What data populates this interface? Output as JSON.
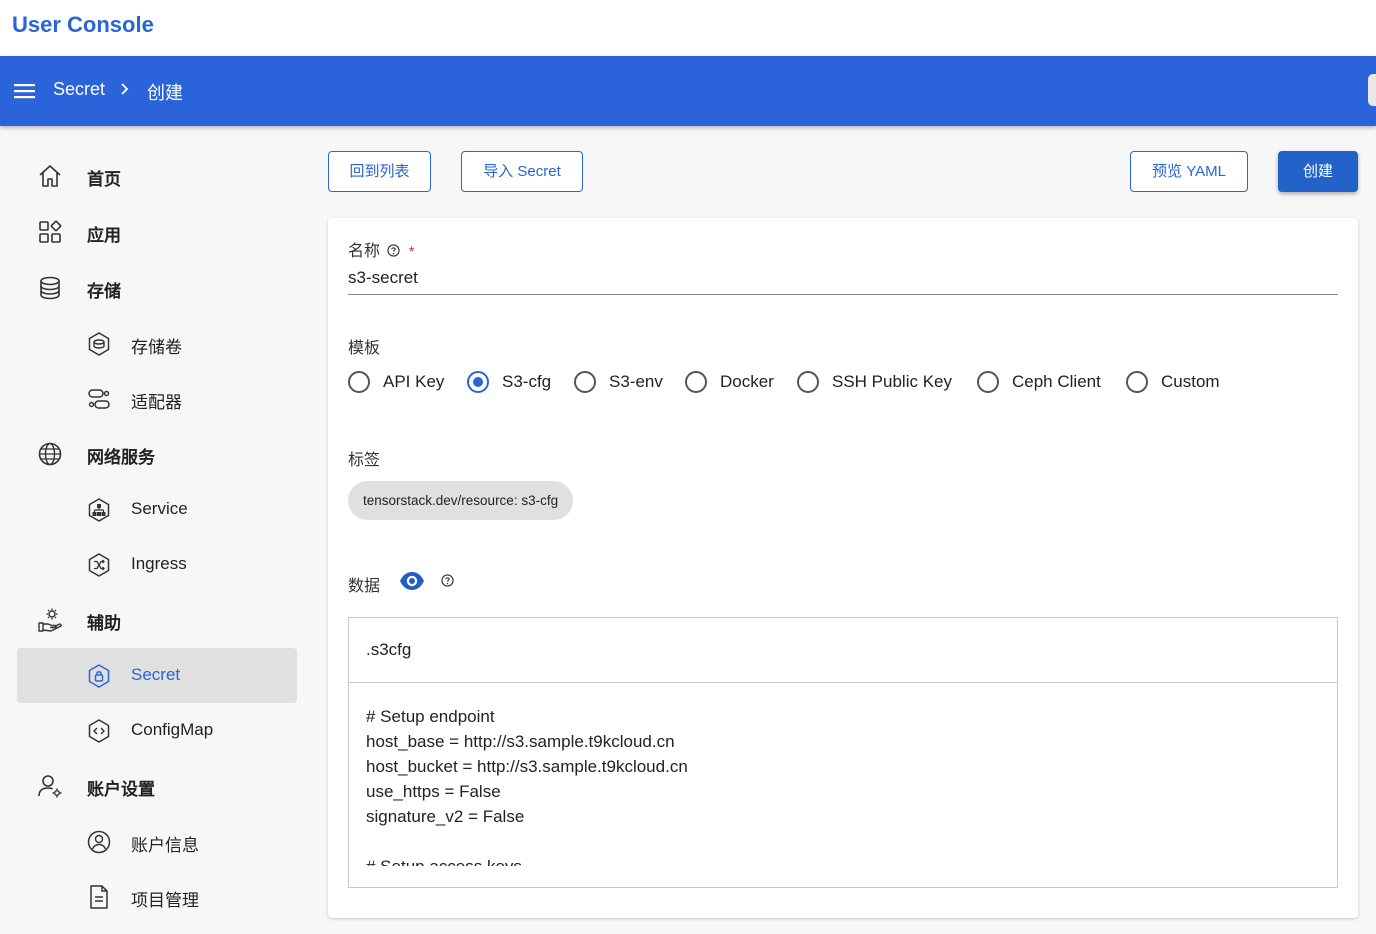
{
  "app": {
    "title": "User Console"
  },
  "breadcrumb": {
    "parent": "Secret",
    "current": "创建"
  },
  "sidebar": {
    "items": [
      {
        "label": "首页",
        "icon": "home-icon"
      },
      {
        "label": "应用",
        "icon": "apps-icon"
      },
      {
        "label": "存储",
        "icon": "database-icon"
      },
      {
        "label": "存储卷",
        "icon": "volume-icon"
      },
      {
        "label": "适配器",
        "icon": "adapter-icon"
      },
      {
        "label": "网络服务",
        "icon": "globe-icon"
      },
      {
        "label": "Service",
        "icon": "service-icon"
      },
      {
        "label": "Ingress",
        "icon": "ingress-icon"
      },
      {
        "label": "辅助",
        "icon": "helper-icon"
      },
      {
        "label": "Secret",
        "icon": "secret-icon",
        "active": true
      },
      {
        "label": "ConfigMap",
        "icon": "configmap-icon"
      },
      {
        "label": "账户设置",
        "icon": "account-settings-icon"
      },
      {
        "label": "账户信息",
        "icon": "account-info-icon"
      },
      {
        "label": "项目管理",
        "icon": "project-icon"
      }
    ]
  },
  "toolbar": {
    "back_label": "回到列表",
    "import_label": "导入 Secret",
    "preview_label": "预览 YAML",
    "create_label": "创建"
  },
  "form": {
    "name_label": "名称",
    "required_mark": "*",
    "name_value": "s3-secret",
    "template_label": "模板",
    "templates": [
      {
        "label": "API Key",
        "checked": false
      },
      {
        "label": "S3-cfg",
        "checked": true
      },
      {
        "label": "S3-env",
        "checked": false
      },
      {
        "label": "Docker",
        "checked": false
      },
      {
        "label": "SSH Public Key",
        "checked": false
      },
      {
        "label": "Ceph Client",
        "checked": false
      },
      {
        "label": "Custom",
        "checked": false
      }
    ],
    "labels_label": "标签",
    "label_chip": "tensorstack.dev/resource: s3-cfg",
    "data_label": "数据",
    "data_key": ".s3cfg",
    "data_value": "# Setup endpoint\nhost_base = http://s3.sample.t9kcloud.cn\nhost_bucket = http://s3.sample.t9kcloud.cn\nuse_https = False\nsignature_v2 = False\n\n# Setup access keys"
  },
  "colors": {
    "primary": "#2b63db",
    "button_primary": "#2363c9",
    "active_bg": "#e0e0e0"
  }
}
